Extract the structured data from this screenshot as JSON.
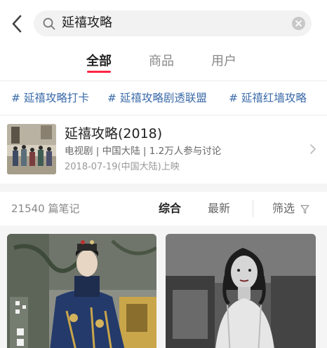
{
  "search": {
    "query": "延禧攻略"
  },
  "tabs": [
    {
      "label": "全部",
      "active": true
    },
    {
      "label": "商品",
      "active": false
    },
    {
      "label": "用户",
      "active": false
    }
  ],
  "hashtags": [
    "# 延禧攻略打卡",
    "# 延禧攻略剧透联盟",
    "# 延禧红墙攻略"
  ],
  "drama": {
    "title": "延禧攻略(2018)",
    "meta": "电视剧 | 中国大陆 | 1.2万人参与讨论",
    "date": "2018-07-19(中国大陆)上映"
  },
  "filterbar": {
    "count": "21540 篇笔记",
    "sort_options": [
      {
        "label": "综合",
        "active": true
      },
      {
        "label": "最新",
        "active": false
      }
    ],
    "filter_label": "筛选"
  },
  "colors": {
    "accent": "#ff2442",
    "hashtag": "#3a6aa8",
    "background_gray": "#f5f5f5"
  },
  "icons": [
    "back-arrow-icon",
    "search-icon",
    "clear-icon",
    "chevron-right-icon",
    "filter-funnel-icon"
  ]
}
